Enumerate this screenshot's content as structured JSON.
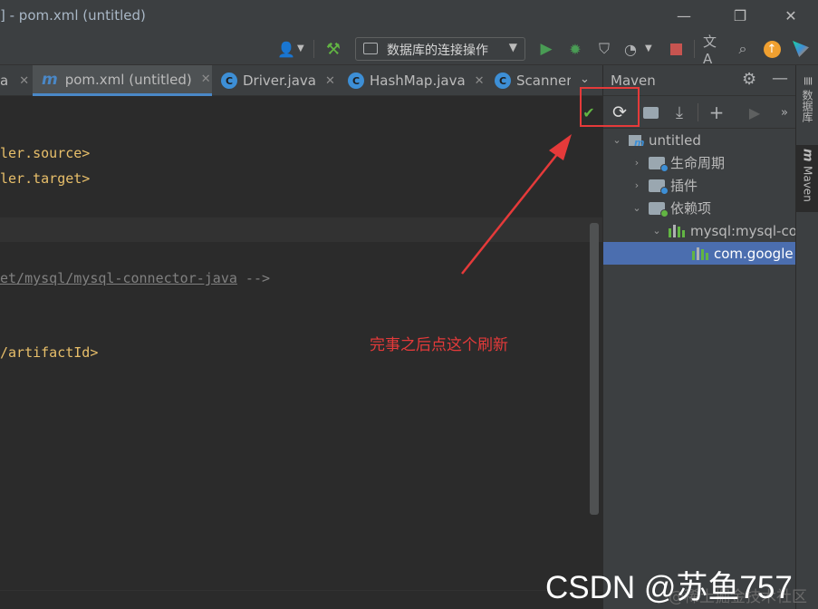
{
  "window": {
    "title": "] - pom.xml (untitled)"
  },
  "toolbar": {
    "run_config_label": "数据库的连接操作"
  },
  "tabs": [
    {
      "label": "a",
      "type": "partial"
    },
    {
      "label": "pom.xml (untitled)",
      "type": "maven",
      "active": true
    },
    {
      "label": "Driver.java",
      "type": "class"
    },
    {
      "label": "HashMap.java",
      "type": "class"
    },
    {
      "label": "Scanner",
      "type": "class"
    }
  ],
  "editor": {
    "lines": {
      "l1": "ler.source>",
      "l2": "ler.target>",
      "comment_link": "et/mysql/mysql-connector-java",
      "comment_end": " -->",
      "l4": "/artifactId>"
    }
  },
  "maven": {
    "title": "Maven",
    "tree": {
      "root": "untitled",
      "lifecycle": "生命周期",
      "plugins": "插件",
      "dependencies": "依赖项",
      "dep_mysql": "mysql:mysql-co",
      "dep_google": "com.google"
    }
  },
  "side_tabs": {
    "database": "数据库",
    "maven": "Maven"
  },
  "annotation": {
    "text": "完事之后点这个刷新",
    "color": "#e53a3a"
  },
  "watermark": {
    "main": "CSDN @苏鱼757",
    "ghost": "@稀土掘金技术社区"
  },
  "colors": {
    "accent": "#4a88c7",
    "selection": "#4b6eaf",
    "run_green": "#499c54",
    "stop_red": "#c75450"
  }
}
